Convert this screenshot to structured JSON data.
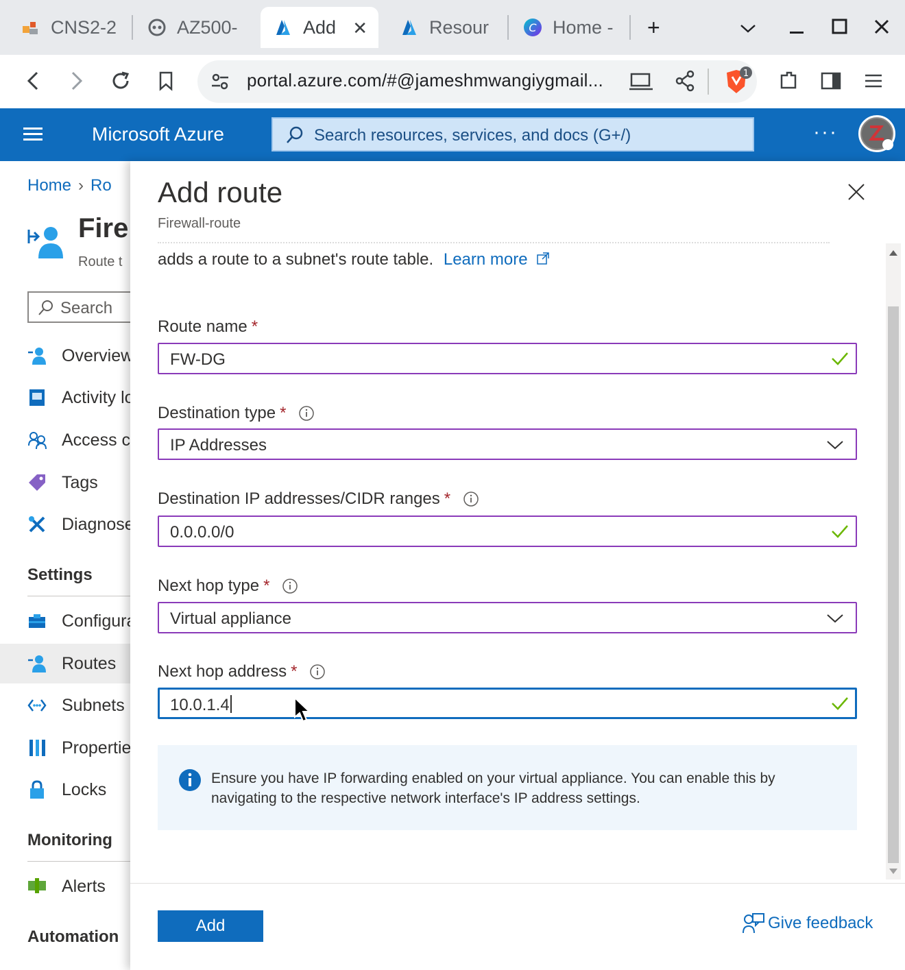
{
  "browser": {
    "tabs": [
      {
        "label": "CNS2-2",
        "icon": "cns-favicon-icon",
        "active": false
      },
      {
        "label": "AZ500-",
        "icon": "github-copilot-icon",
        "active": false
      },
      {
        "label": "Add",
        "icon": "azure-icon",
        "active": true
      },
      {
        "label": "Resour",
        "icon": "azure-icon",
        "active": false
      },
      {
        "label": "Home -",
        "icon": "canva-icon",
        "active": false
      }
    ],
    "new_tab": "+",
    "url": "portal.azure.com/#@jameshmwangiygmail...",
    "extension_badge": "1"
  },
  "azure": {
    "brand": "Microsoft Azure",
    "search_placeholder": "Search resources, services, and docs (G+/)",
    "more": "···"
  },
  "background_blade": {
    "breadcrumb": [
      "Home",
      "Ro"
    ],
    "title": "Fire",
    "subtitle": "Route t",
    "search_placeholder": "Search",
    "menu": [
      {
        "label": "Overview",
        "icon": "overview-icon"
      },
      {
        "label": "Activity lo",
        "icon": "activity-log-icon"
      },
      {
        "label": "Access co",
        "icon": "access-control-icon"
      },
      {
        "label": "Tags",
        "icon": "tag-icon"
      },
      {
        "label": "Diagnose",
        "icon": "diagnose-icon"
      }
    ],
    "settings_heading": "Settings",
    "settings_menu": [
      {
        "label": "Configura",
        "icon": "configuration-icon"
      },
      {
        "label": "Routes",
        "icon": "routes-icon",
        "selected": true
      },
      {
        "label": "Subnets",
        "icon": "subnets-icon"
      },
      {
        "label": "Propertie",
        "icon": "properties-icon"
      },
      {
        "label": "Locks",
        "icon": "lock-icon"
      }
    ],
    "monitoring_heading": "Monitoring",
    "monitoring_menu": [
      {
        "label": "Alerts",
        "icon": "alerts-icon"
      }
    ],
    "automation_heading": "Automation"
  },
  "panel": {
    "title": "Add route",
    "subtitle": "Firewall-route",
    "intro_text": "adds a route to a subnet's route table.",
    "learn_more": "Learn more",
    "fields": {
      "route_name": {
        "label": "Route name",
        "value": "FW-DG"
      },
      "destination_type": {
        "label": "Destination type",
        "value": "IP Addresses"
      },
      "destination_ip": {
        "label": "Destination IP addresses/CIDR ranges",
        "value": "0.0.0.0/0"
      },
      "next_hop_type": {
        "label": "Next hop type",
        "value": "Virtual appliance"
      },
      "next_hop_address": {
        "label": "Next hop address",
        "value": "10.0.1.4"
      }
    },
    "required_mark": "*",
    "info_message": "Ensure you have IP forwarding enabled on your virtual appliance. You can enable this by navigating to the respective network interface's IP address settings.",
    "add_button": "Add",
    "feedback": "Give feedback"
  },
  "colors": {
    "azure_blue": "#0f6cbd",
    "field_border": "#8a3ab9",
    "valid_check": "#6bb700",
    "required": "#a4262c"
  }
}
